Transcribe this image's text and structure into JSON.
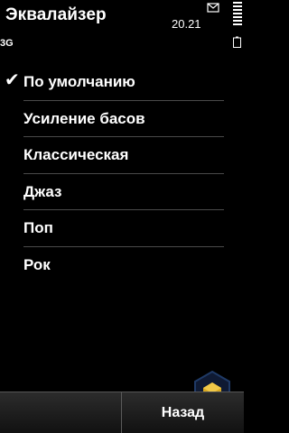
{
  "status": {
    "title": "Эквалайзер",
    "time": "20.21",
    "network": "3G",
    "icons": [
      "envelope-icon",
      "signal-strength-icon",
      "battery-icon"
    ]
  },
  "equalizer": {
    "selected": "По умолчанию",
    "presets": [
      {
        "label": "По умолчанию",
        "checked": true
      },
      {
        "label": "Усиление басов",
        "checked": false
      },
      {
        "label": "Классическая",
        "checked": false
      },
      {
        "label": "Джаз",
        "checked": false
      },
      {
        "label": "Поп",
        "checked": false
      },
      {
        "label": "Рок",
        "checked": false
      }
    ],
    "check_glyph": "✔"
  },
  "softkeys": {
    "left": "",
    "right": "Назад"
  },
  "colors": {
    "background": "#000000",
    "text": "#ffffff",
    "separator": "#4a4a4a",
    "watermark": "#d8a820"
  }
}
